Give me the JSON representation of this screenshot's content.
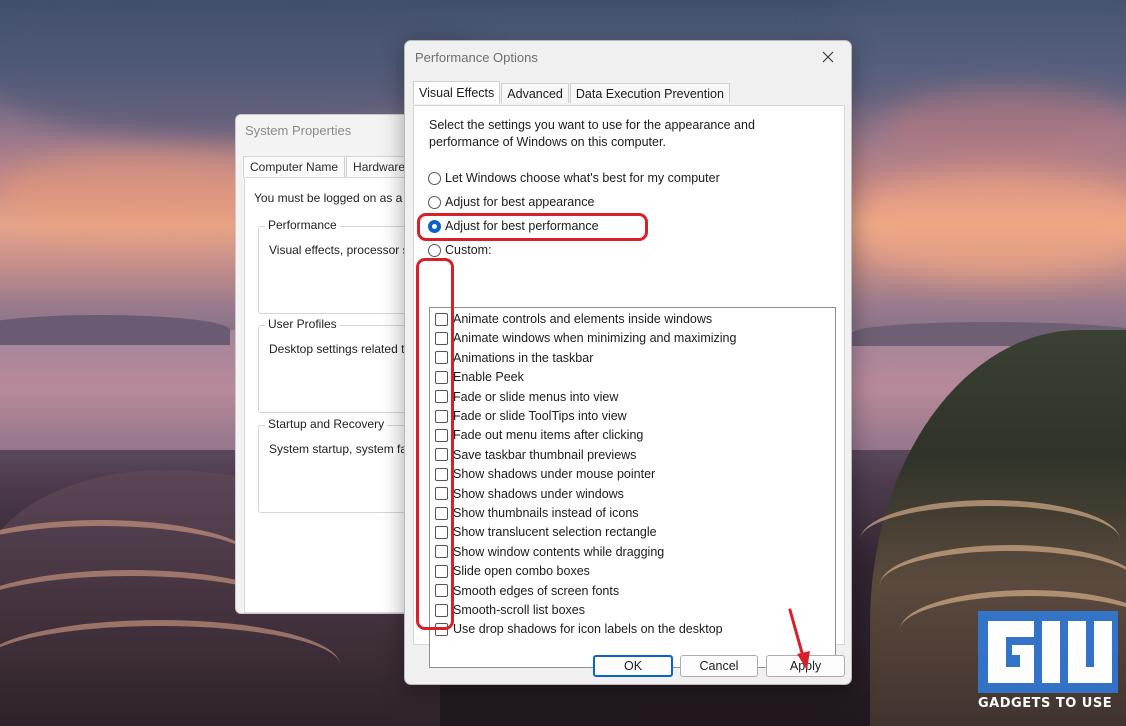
{
  "desktop": {
    "system_properties": {
      "title": "System Properties",
      "tabs": [
        "Computer Name",
        "Hardware"
      ],
      "intro": "You must be logged on as a",
      "groups": [
        {
          "label": "Performance",
          "desc": "Visual effects, processor sc"
        },
        {
          "label": "User Profiles",
          "desc": "Desktop settings related to"
        },
        {
          "label": "Startup and Recovery",
          "desc": "System startup, system failu"
        }
      ]
    }
  },
  "dialog": {
    "title": "Performance Options",
    "close_icon": "close-icon",
    "tabs": [
      {
        "label": "Visual Effects",
        "active": true
      },
      {
        "label": "Advanced",
        "active": false
      },
      {
        "label": "Data Execution Prevention",
        "active": false
      }
    ],
    "intro_text": "Select the settings you want to use for the appearance and performance of Windows on this computer.",
    "radios": [
      {
        "label": "Let Windows choose what's best for my computer",
        "checked": false
      },
      {
        "label": "Adjust for best appearance",
        "checked": false
      },
      {
        "label": "Adjust for best performance",
        "checked": true
      },
      {
        "label": "Custom:",
        "checked": false
      }
    ],
    "effects": [
      {
        "label": "Animate controls and elements inside windows",
        "checked": false
      },
      {
        "label": "Animate windows when minimizing and maximizing",
        "checked": false
      },
      {
        "label": "Animations in the taskbar",
        "checked": false
      },
      {
        "label": "Enable Peek",
        "checked": false
      },
      {
        "label": "Fade or slide menus into view",
        "checked": false
      },
      {
        "label": "Fade or slide ToolTips into view",
        "checked": false
      },
      {
        "label": "Fade out menu items after clicking",
        "checked": false
      },
      {
        "label": "Save taskbar thumbnail previews",
        "checked": false
      },
      {
        "label": "Show shadows under mouse pointer",
        "checked": false
      },
      {
        "label": "Show shadows under windows",
        "checked": false
      },
      {
        "label": "Show thumbnails instead of icons",
        "checked": false
      },
      {
        "label": "Show translucent selection rectangle",
        "checked": false
      },
      {
        "label": "Show window contents while dragging",
        "checked": false
      },
      {
        "label": "Slide open combo boxes",
        "checked": false
      },
      {
        "label": "Smooth edges of screen fonts",
        "checked": false
      },
      {
        "label": "Smooth-scroll list boxes",
        "checked": false
      },
      {
        "label": "Use drop shadows for icon labels on the desktop",
        "checked": false
      }
    ],
    "buttons": {
      "ok": "OK",
      "cancel": "Cancel",
      "apply": "Apply"
    }
  },
  "annotations": {
    "color": "#d8202a"
  },
  "watermark": {
    "text": "GADGETS TO USE",
    "logo_color": "#2f7de0"
  }
}
